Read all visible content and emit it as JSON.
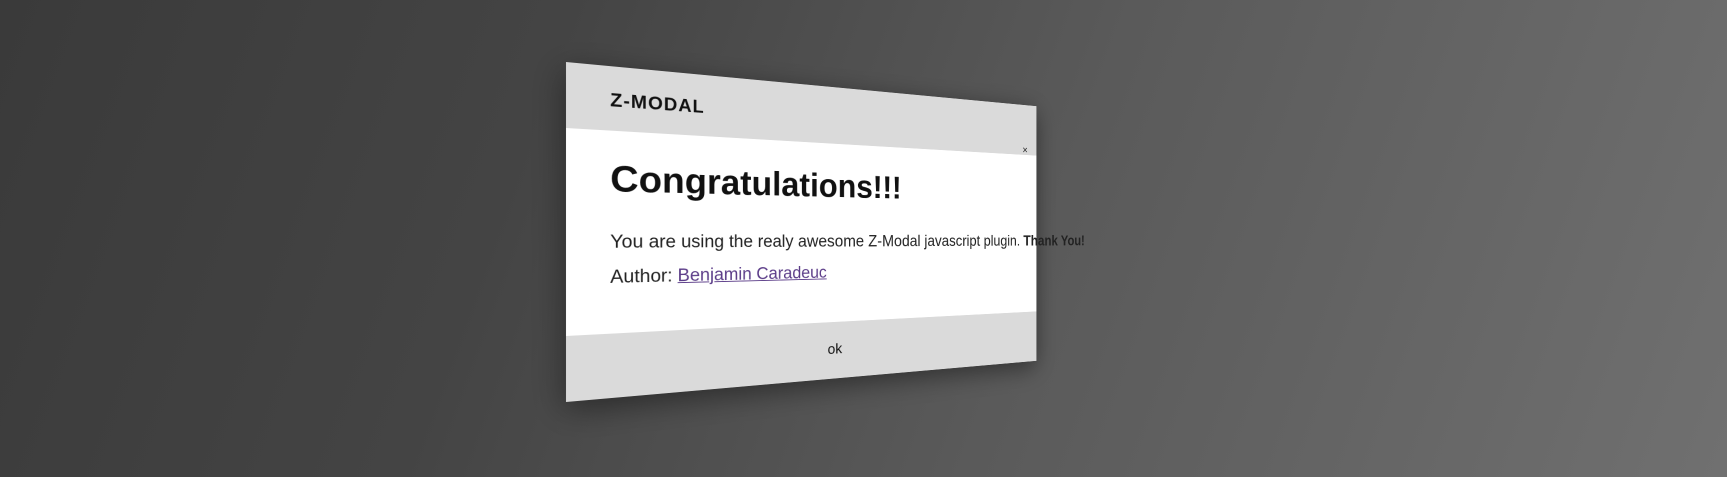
{
  "modal": {
    "title": "Z-MODAL",
    "close_label": "×",
    "headline": "Congratulations!!!",
    "message_text": "You are using the realy awesome Z-Modal javascript plugin. ",
    "message_bold": "Thank You!",
    "author_label": "Author: ",
    "author_name": "Benjamin Caradeuc",
    "ok_label": "ok"
  },
  "colors": {
    "header_bg": "#dadada",
    "link": "#5b3c88",
    "backdrop_dark": "#3a3a3a",
    "backdrop_light": "#707070"
  }
}
